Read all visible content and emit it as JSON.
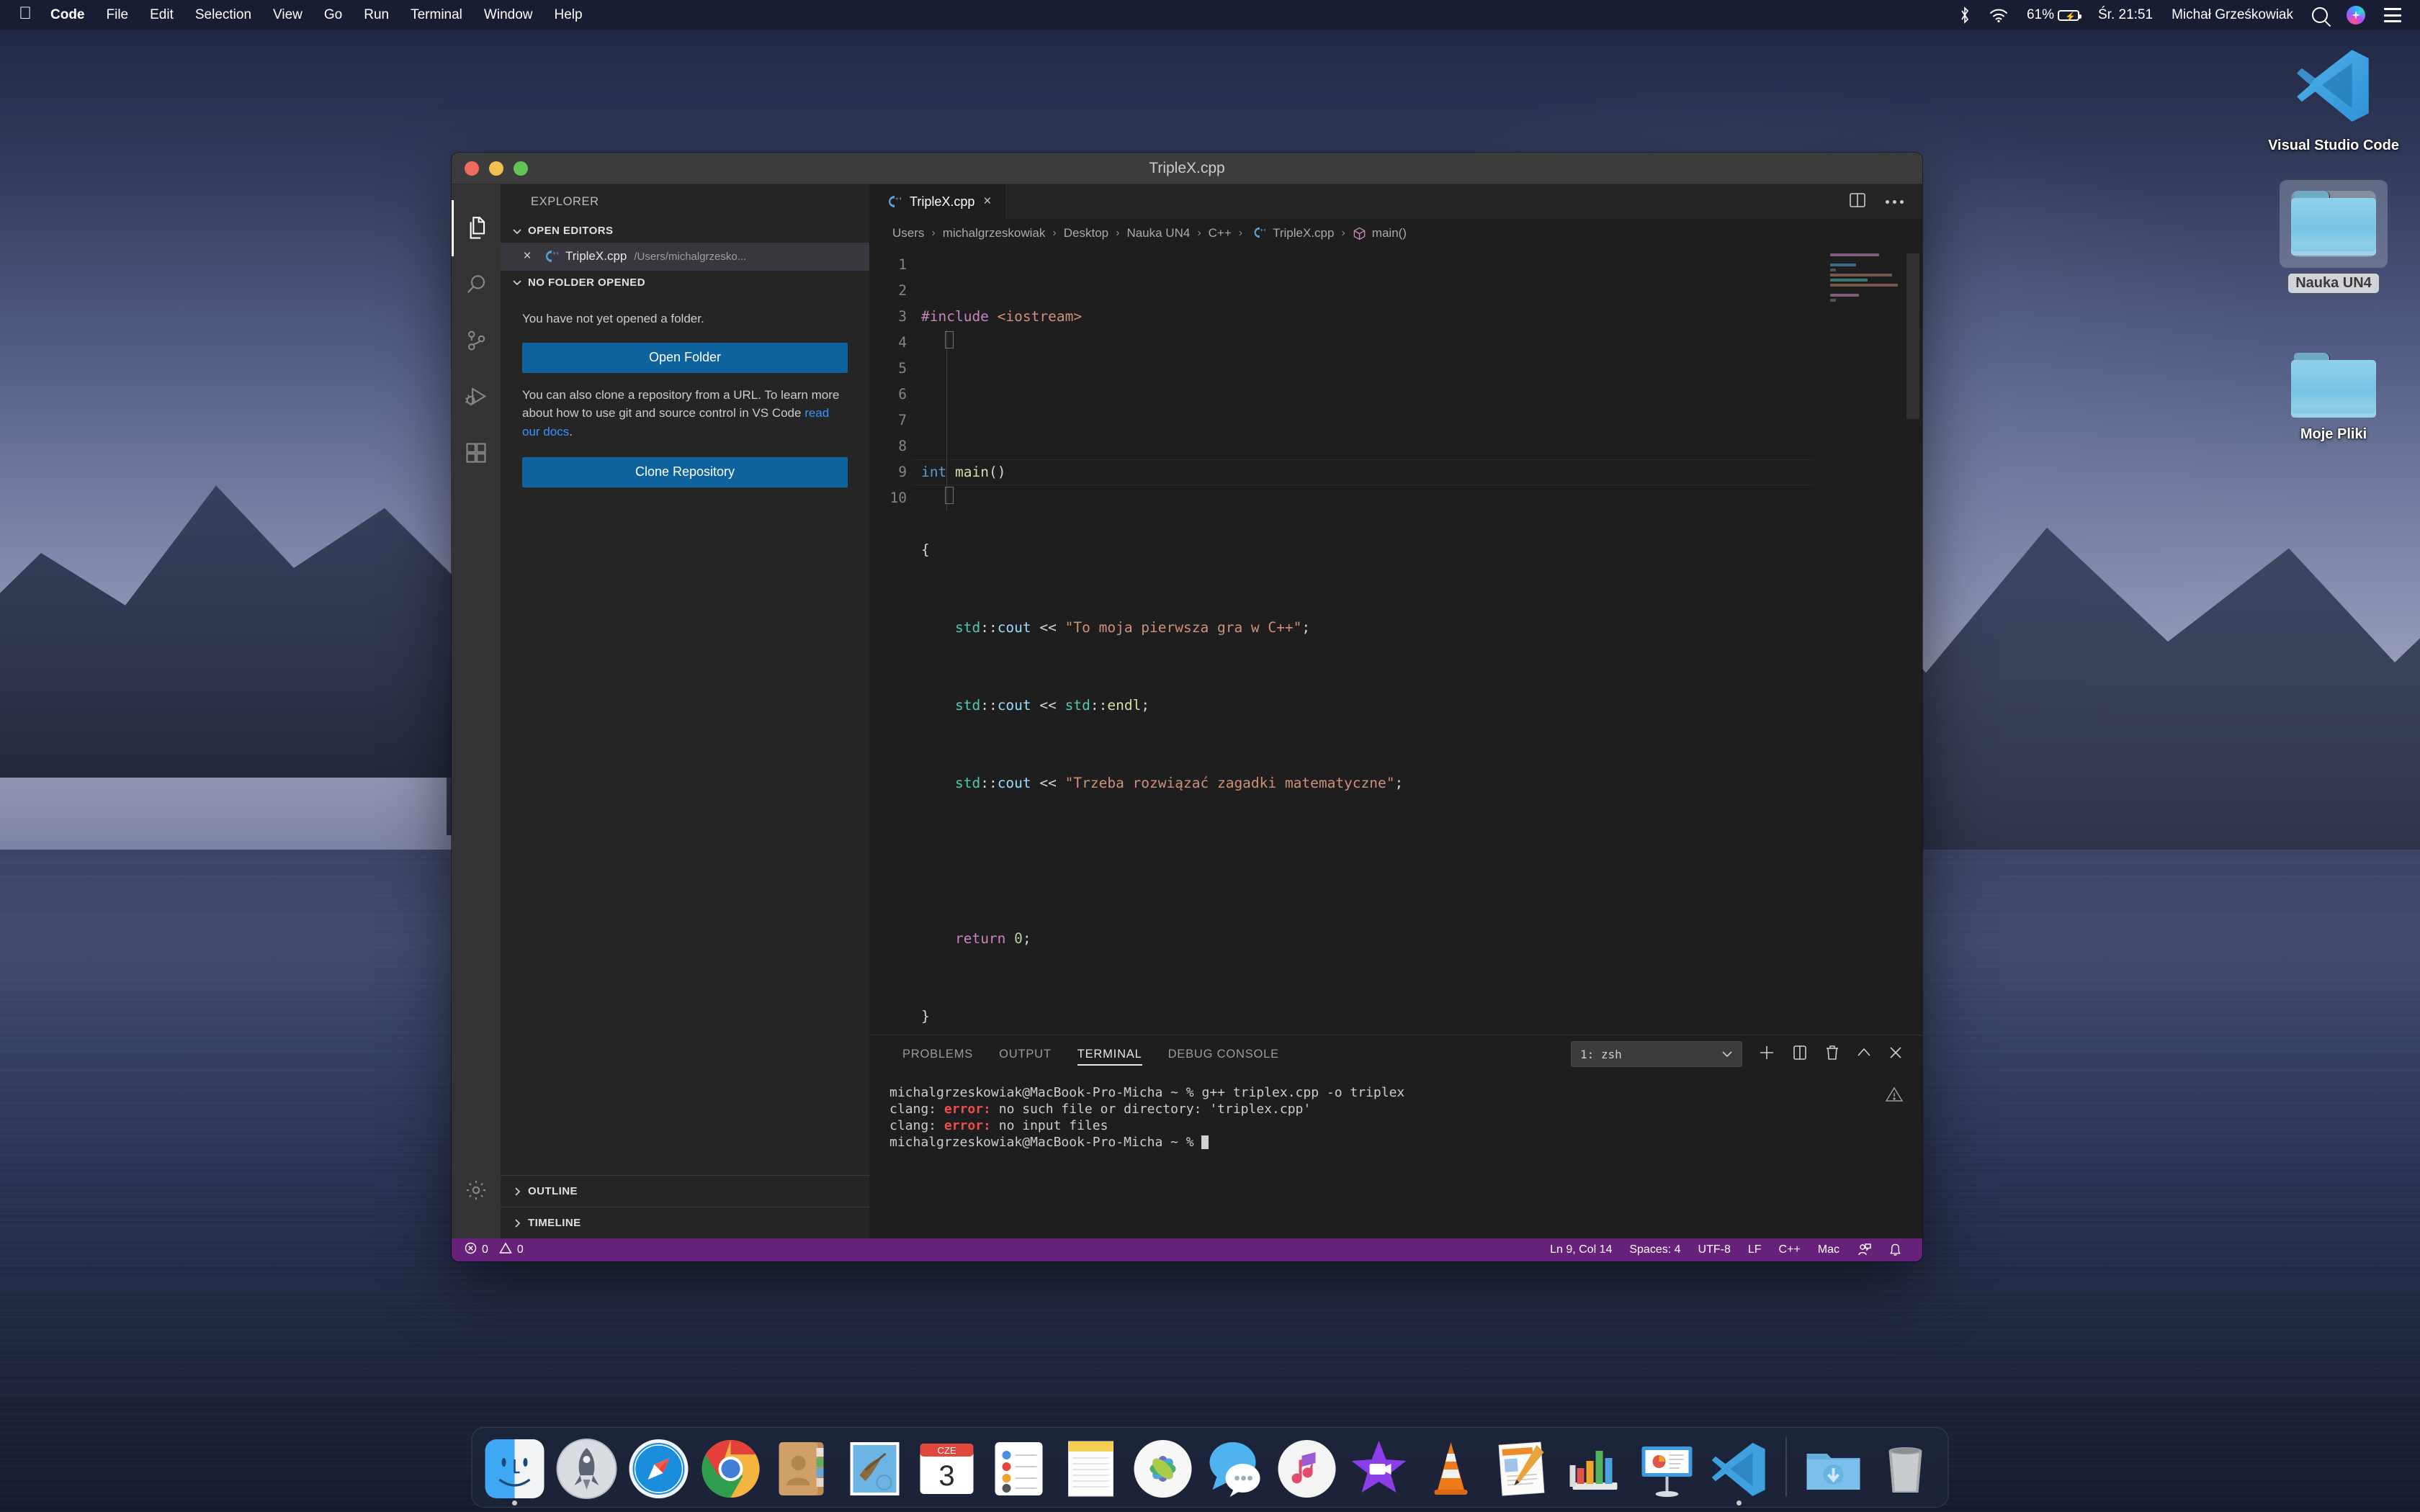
{
  "menubar": {
    "apple_icon": "apple-logo-icon",
    "items": [
      {
        "label": "Code",
        "bold": true
      },
      {
        "label": "File",
        "bold": false
      },
      {
        "label": "Edit",
        "bold": false
      },
      {
        "label": "Selection",
        "bold": false
      },
      {
        "label": "View",
        "bold": false
      },
      {
        "label": "Go",
        "bold": false
      },
      {
        "label": "Run",
        "bold": false
      },
      {
        "label": "Terminal",
        "bold": false
      },
      {
        "label": "Window",
        "bold": false
      },
      {
        "label": "Help",
        "bold": false
      }
    ],
    "status": {
      "bluetooth_icon": "bluetooth-icon",
      "wifi_icon": "wifi-icon",
      "battery_percent": "61%",
      "battery_icon": "battery-charging-icon",
      "datetime": "Śr. 21:51",
      "user": "Michał Grześkowiak",
      "search_icon": "spotlight-search-icon",
      "siri_icon": "siri-icon",
      "control_center_icon": "control-center-icon"
    }
  },
  "desktop": {
    "icons": [
      {
        "name": "Visual Studio Code",
        "type": "app",
        "selected": false
      },
      {
        "name": "Nauka UN4",
        "type": "folder",
        "selected": true
      },
      {
        "name": "Moje Pliki",
        "type": "folder",
        "selected": false
      }
    ]
  },
  "vscode": {
    "window_title": "TripleX.cpp",
    "traffic_lights": [
      "close-button",
      "minimize-button",
      "maximize-button"
    ],
    "activitybar": [
      {
        "name": "explorer",
        "icon": "files-icon",
        "active": true
      },
      {
        "name": "search",
        "icon": "search-icon",
        "active": false
      },
      {
        "name": "source-control",
        "icon": "source-control-icon",
        "active": false
      },
      {
        "name": "run-and-debug",
        "icon": "run-debug-icon",
        "active": false
      },
      {
        "name": "extensions",
        "icon": "extensions-icon",
        "active": false
      },
      {
        "name": "manage",
        "icon": "gear-icon",
        "active": false
      }
    ],
    "sidebar": {
      "title": "EXPLORER",
      "open_editors": {
        "header": "OPEN EDITORS",
        "items": [
          {
            "close": "×",
            "icon": "cpp-file-icon",
            "name": "TripleX.cpp",
            "path": "/Users/michalgrzesko..."
          }
        ]
      },
      "no_folder": {
        "header": "NO FOLDER OPENED",
        "message": "You have not yet opened a folder.",
        "open_folder_button": "Open Folder",
        "clone_text_1": "You can also clone a repository from a URL. To learn more about how to use git and source control in VS Code ",
        "clone_link": "read our docs",
        "clone_text_2": ".",
        "clone_button": "Clone Repository"
      },
      "bottom_sections": [
        {
          "label": "OUTLINE"
        },
        {
          "label": "TIMELINE"
        }
      ]
    },
    "editor": {
      "tab": {
        "icon": "cpp-file-icon",
        "label": "TripleX.cpp",
        "close": "×"
      },
      "actions": [
        {
          "name": "split-editor",
          "icon": "split-editor-icon"
        },
        {
          "name": "more-actions",
          "icon": "ellipsis-icon"
        }
      ],
      "breadcrumb": [
        "Users",
        "michalgrzeskowiak",
        "Desktop",
        "Nauka UN4",
        "C++",
        "TripleX.cpp",
        "main()"
      ],
      "breadcrumb_file_icon": "cpp-file-icon",
      "breadcrumb_symbol_icon": "cube-symbol-icon",
      "line_numbers": [
        "1",
        "2",
        "3",
        "4",
        "5",
        "6",
        "7",
        "8",
        "9",
        "10"
      ],
      "code_lines": [
        "#include <iostream>",
        "",
        "int main()",
        "{",
        "    std::cout << \"To moja pierwsza gra w C++\";",
        "    std::cout << std::endl;",
        "    std::cout << \"Trzeba rozwiązać zagadki matematyczne\";",
        "",
        "    return 0;",
        "}"
      ]
    },
    "panel": {
      "tabs": [
        {
          "label": "PROBLEMS",
          "active": false
        },
        {
          "label": "OUTPUT",
          "active": false
        },
        {
          "label": "TERMINAL",
          "active": true
        },
        {
          "label": "DEBUG CONSOLE",
          "active": false
        }
      ],
      "terminal_select": "1: zsh",
      "actions": [
        {
          "name": "new-terminal",
          "icon": "plus-icon"
        },
        {
          "name": "split-terminal",
          "icon": "split-icon"
        },
        {
          "name": "kill-terminal",
          "icon": "trash-icon"
        },
        {
          "name": "maximize-panel",
          "icon": "chevron-up-icon"
        },
        {
          "name": "close-panel",
          "icon": "close-icon"
        }
      ],
      "terminal_lines": [
        {
          "type": "prompt",
          "prefix": "michalgrzeskowiak@MacBook-Pro-Micha ~ % ",
          "command": "g++ triplex.cpp -o triplex"
        },
        {
          "type": "error",
          "before": "clang: ",
          "keyword": "error:",
          "after": " no such file or directory: 'triplex.cpp'"
        },
        {
          "type": "error",
          "before": "clang: ",
          "keyword": "error:",
          "after": " no input files"
        },
        {
          "type": "prompt",
          "prefix": "michalgrzeskowiak@MacBook-Pro-Micha ~ % ",
          "command": ""
        }
      ],
      "warning_icon": "warning-triangle-icon"
    },
    "statusbar": {
      "errors_icon": "error-circle-icon",
      "errors": "0",
      "warnings_icon": "warning-triangle-icon",
      "warnings": "0",
      "items": [
        {
          "label": "Ln 9, Col 14",
          "name": "cursor-position"
        },
        {
          "label": "Spaces: 4",
          "name": "indentation"
        },
        {
          "label": "UTF-8",
          "name": "encoding"
        },
        {
          "label": "LF",
          "name": "eol"
        },
        {
          "label": "C++",
          "name": "language-mode"
        },
        {
          "label": "Mac",
          "name": "platform"
        }
      ],
      "feedback_icon": "feedback-icon",
      "bell_icon": "bell-icon",
      "accent_color": "#68217a"
    }
  },
  "dock": {
    "items": [
      {
        "name": "Finder",
        "icon": "finder-icon",
        "running": true
      },
      {
        "name": "Launchpad",
        "icon": "launchpad-icon",
        "running": false
      },
      {
        "name": "Safari",
        "icon": "safari-icon",
        "running": false
      },
      {
        "name": "Google Chrome",
        "icon": "chrome-icon",
        "running": false
      },
      {
        "name": "Contacts",
        "icon": "contacts-icon",
        "running": false
      },
      {
        "name": "Mail",
        "icon": "mail-icon",
        "running": false
      },
      {
        "name": "Calendar",
        "icon": "calendar-icon",
        "running": false,
        "month": "CZE",
        "day": "3"
      },
      {
        "name": "Reminders",
        "icon": "reminders-icon",
        "running": false
      },
      {
        "name": "Notes",
        "icon": "notes-icon",
        "running": false
      },
      {
        "name": "Photos",
        "icon": "photos-icon",
        "running": false
      },
      {
        "name": "Messages",
        "icon": "messages-icon",
        "running": false
      },
      {
        "name": "iTunes",
        "icon": "itunes-icon",
        "running": false
      },
      {
        "name": "iMovie",
        "icon": "imovie-icon",
        "running": false
      },
      {
        "name": "VLC",
        "icon": "vlc-icon",
        "running": false
      },
      {
        "name": "Pages",
        "icon": "pages-icon",
        "running": false
      },
      {
        "name": "Numbers",
        "icon": "numbers-icon",
        "running": false
      },
      {
        "name": "Keynote",
        "icon": "keynote-icon",
        "running": false
      },
      {
        "name": "Visual Studio Code",
        "icon": "vscode-icon",
        "running": true
      }
    ],
    "right_items": [
      {
        "name": "Downloads",
        "icon": "downloads-folder-icon"
      },
      {
        "name": "Trash",
        "icon": "trash-icon"
      }
    ]
  }
}
